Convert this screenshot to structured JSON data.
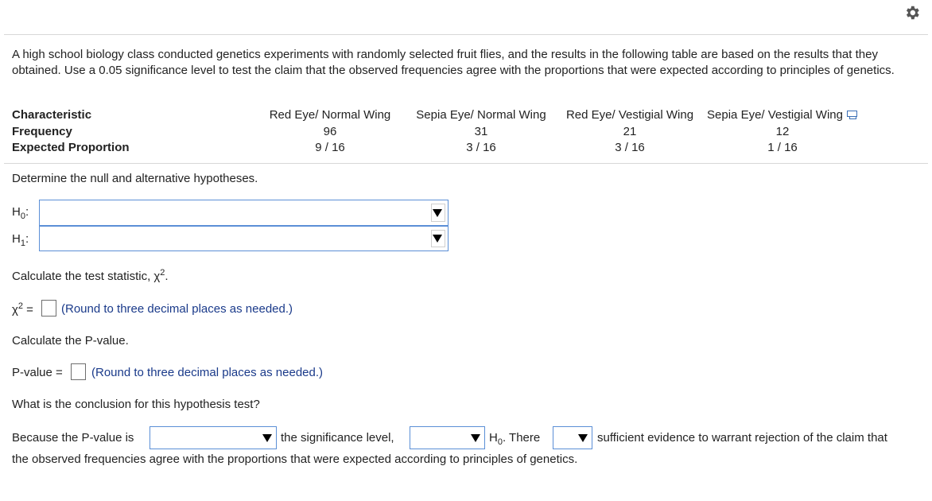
{
  "toolbar": {
    "settings_icon": "gear-icon"
  },
  "question": {
    "prompt": "A high school biology class conducted genetics experiments with randomly selected fruit flies, and the results in the following table are based on the results that they obtained. Use a 0.05 significance level to test the claim that the observed frequencies agree with the proportions that were expected according to principles of genetics."
  },
  "table": {
    "header_label": "Characteristic",
    "columns": [
      "Red Eye/ Normal Wing",
      "Sepia Eye/ Normal Wing",
      "Red Eye/ Vestigial Wing",
      "Sepia Eye/ Vestigial Wing"
    ],
    "rows": [
      {
        "label": "Frequency",
        "values": [
          "96",
          "31",
          "21",
          "12"
        ]
      },
      {
        "label": "Expected Proportion",
        "values": [
          "9 / 16",
          "3 / 16",
          "3 / 16",
          "1 / 16"
        ]
      }
    ],
    "copy_icon": "copy-table-icon"
  },
  "hypotheses": {
    "instruction": "Determine the null and alternative hypotheses.",
    "h0_letter": "H",
    "h0_sub": "0",
    "h0_colon": ":",
    "h1_letter": "H",
    "h1_sub": "1",
    "h1_colon": ":",
    "h0_value": "",
    "h1_value": ""
  },
  "statistic": {
    "instruction_pre": "Calculate the test statistic, χ",
    "instruction_sup": "2",
    "instruction_post": ".",
    "label_chi": "χ",
    "label_sup": "2",
    "label_eq": " =",
    "value": "",
    "hint": "(Round to three decimal places as needed.)"
  },
  "pvalue": {
    "instruction": "Calculate the P-value.",
    "label": "P-value =",
    "value": "",
    "hint": "(Round to three decimal places as needed.)"
  },
  "conclusion": {
    "question": "What is the conclusion for this hypothesis test?",
    "part1": "Because the P-value is",
    "select1_value": "",
    "part2": "the significance level,",
    "select2_value": "",
    "h0_letter": "H",
    "h0_sub": "0",
    "part3": ". There",
    "select3_value": "",
    "part4": "sufficient evidence to warrant rejection of the claim that",
    "line2": "the observed frequencies agree with the proportions that were expected according to principles of genetics."
  }
}
